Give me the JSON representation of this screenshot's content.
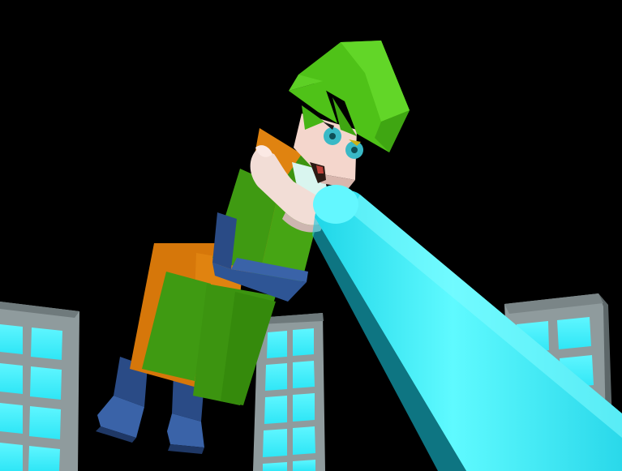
{
  "scene": {
    "background": "#000000",
    "accent_beam": "#33ffff",
    "building_wall": "#8a9799",
    "building_window": "#33f0ff",
    "hero_hair": "#4fc218",
    "hero_gi_orange": "#d6770a",
    "hero_gi_green": "#3f9a12",
    "hero_belt": "#2c4f86",
    "hero_boots": "#2e5595",
    "hero_skin": "#f2d2c8",
    "hero_eyes": "#39b9c6",
    "icons": [
      "building-icon",
      "hero-character",
      "energy-beam"
    ]
  }
}
